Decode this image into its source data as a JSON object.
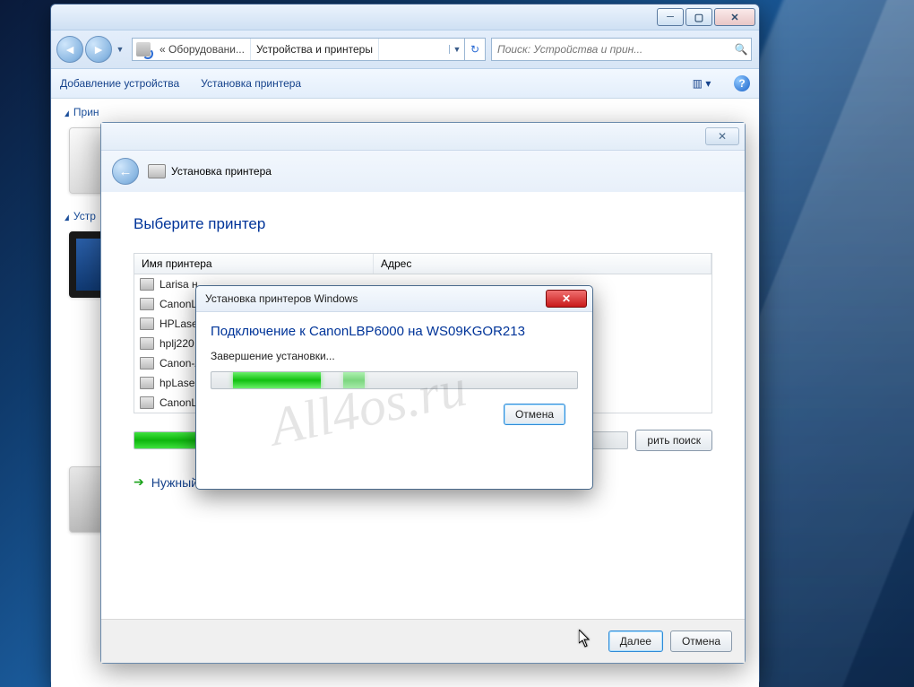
{
  "watermark": "All4os.ru",
  "explorer": {
    "breadcrumb": {
      "prefix_icon": "devices-icon",
      "seg1": "« Оборудовани...",
      "seg2": "Устройства и принтеры"
    },
    "search_placeholder": "Поиск: Устройства и прин...",
    "toolbar": {
      "add_device": "Добавление устройства",
      "add_printer": "Установка принтера"
    },
    "sections": {
      "printers": "Прин",
      "devices": "Устр"
    }
  },
  "wizard": {
    "title": "Установка принтера",
    "heading": "Выберите принтер",
    "columns": {
      "name": "Имя принтера",
      "address": "Адрес"
    },
    "rows": [
      "Larisa н",
      "CanonL",
      "HPLaser",
      "hplj220",
      "Canon-A",
      "hpLaser",
      "CanonL"
    ],
    "search_again": "рить поиск",
    "not_listed": "Нужный принтер отсутствует в списке",
    "next": "Далее",
    "cancel": "Отмена"
  },
  "mini": {
    "title": "Установка принтеров Windows",
    "heading": "Подключение к CanonLBP6000 на WS09KGOR213",
    "status": "Завершение установки...",
    "cancel": "Отмена"
  }
}
